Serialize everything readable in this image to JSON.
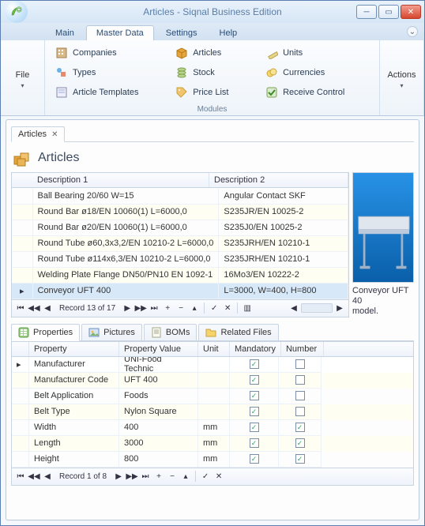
{
  "window": {
    "title": "Articles - Siqnal Business Edition"
  },
  "menu": {
    "tabs": [
      "Main",
      "Master Data",
      "Settings",
      "Help"
    ],
    "active": 1
  },
  "ribbon": {
    "file": "File",
    "actions": "Actions",
    "group_label": "Modules",
    "items": [
      {
        "label": "Companies",
        "icon": "building"
      },
      {
        "label": "Types",
        "icon": "shapes"
      },
      {
        "label": "Article Templates",
        "icon": "template"
      },
      {
        "label": "Articles",
        "icon": "box"
      },
      {
        "label": "Stock",
        "icon": "stack"
      },
      {
        "label": "Price List",
        "icon": "pricetag"
      },
      {
        "label": "Units",
        "icon": "ruler"
      },
      {
        "label": "Currencies",
        "icon": "coins"
      },
      {
        "label": "Receive Control",
        "icon": "check"
      }
    ]
  },
  "doc_tab": {
    "label": "Articles"
  },
  "heading": "Articles",
  "grid": {
    "cols": [
      "Description 1",
      "Description 2"
    ],
    "rows": [
      {
        "d1": "Ball Bearing 20/60 W=15",
        "d2": "Angular Contact SKF"
      },
      {
        "d1": "Round Bar ø18/EN 10060(1) L=6000,0",
        "d2": "S235JR/EN 10025-2"
      },
      {
        "d1": "Round Bar ø20/EN 10060(1) L=6000,0",
        "d2": "S235J0/EN 10025-2"
      },
      {
        "d1": "Round Tube ø60,3x3,2/EN 10210-2 L=6000,0",
        "d2": "S235JRH/EN 10210-1"
      },
      {
        "d1": "Round Tube ø114x6,3/EN 10210-2 L=6000,0",
        "d2": "S235JRH/EN 10210-1"
      },
      {
        "d1": "Welding Plate Flange DN50/PN10 EN 1092-1",
        "d2": "16Mo3/EN 10222-2"
      },
      {
        "d1": "Conveyor UFT 400",
        "d2": "L=3000, W=400, H=800"
      }
    ],
    "selected": 6,
    "nav": "Record 13 of 17"
  },
  "preview": {
    "caption_line1": "Conveyor UFT 40",
    "caption_line2": "model."
  },
  "subtabs": [
    "Properties",
    "Pictures",
    "BOMs",
    "Related Files"
  ],
  "props": {
    "cols": [
      "Property",
      "Property Value",
      "Unit",
      "Mandatory",
      "Number"
    ],
    "rows": [
      {
        "p": "Manufacturer",
        "v": "UNI-Food Technic",
        "u": "",
        "m": true,
        "n": false
      },
      {
        "p": "Manufacturer Code",
        "v": "UFT 400",
        "u": "",
        "m": true,
        "n": false
      },
      {
        "p": "Belt Application",
        "v": "Foods",
        "u": "",
        "m": true,
        "n": false
      },
      {
        "p": "Belt Type",
        "v": "Nylon Square",
        "u": "",
        "m": true,
        "n": false
      },
      {
        "p": "Width",
        "v": "400",
        "u": "mm",
        "m": true,
        "n": true
      },
      {
        "p": "Length",
        "v": "3000",
        "u": "mm",
        "m": true,
        "n": true
      },
      {
        "p": "Height",
        "v": "800",
        "u": "mm",
        "m": true,
        "n": true
      }
    ],
    "nav": "Record 1 of 8"
  }
}
